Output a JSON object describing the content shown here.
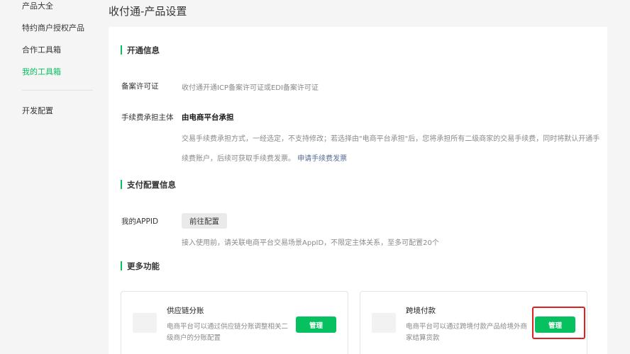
{
  "sidebar": {
    "items": [
      {
        "label": "产品大全"
      },
      {
        "label": "特约商户授权产品"
      },
      {
        "label": "合作工具箱"
      },
      {
        "label": "我的工具箱"
      },
      {
        "label": "开发配置"
      }
    ],
    "active_index": 3
  },
  "page": {
    "title": "收付通-产品设置"
  },
  "sections": {
    "open_info": {
      "title": "开通信息",
      "license_label": "备案许可证",
      "license_value": "收付通开通ICP备案许可证或EDI备案许可证",
      "fee_label": "手续费承担主体",
      "fee_value": "由电商平台承担",
      "fee_desc_line1": "交易手续费承担方式，一经选定，不支持修改；若选择由\"电商平台承担\"后，您将承担所有二级商家的交易手续费，同时将默认开通手",
      "fee_desc_line2": "续费账户，后续可获取手续费发票。",
      "fee_link": "申请手续费发票"
    },
    "pay_config": {
      "title": "支付配置信息",
      "appid_label": "我的APPID",
      "appid_button": "前往配置",
      "appid_desc": "接入使用前，请关联电商平台交易场景AppID，不限定主体关系，至多可配置20个"
    },
    "more": {
      "title": "更多功能",
      "cards": [
        {
          "name": "供应链分账",
          "desc_line1": "电商平台可以通过供应链分账调整相关二",
          "desc_line2": "级商户的分账配置",
          "button": "管理"
        },
        {
          "name": "跨境付款",
          "desc_line1": "电商平台可以通过跨境付款产品给境外商",
          "desc_line2": "家结算货款",
          "button": "管理"
        }
      ]
    }
  },
  "colors": {
    "accent": "#07c160",
    "link": "#576b95",
    "highlight": "#e02020"
  }
}
